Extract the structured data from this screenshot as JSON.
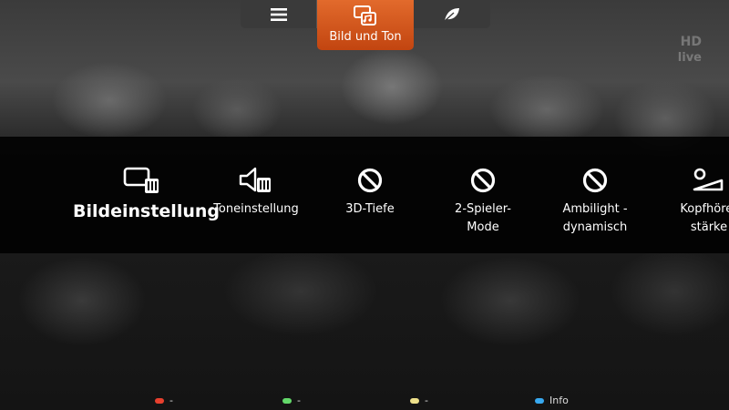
{
  "channel": {
    "name": "HD",
    "status": "live"
  },
  "tabs": [
    {
      "icon": "menu-icon",
      "label": ""
    },
    {
      "icon": "picture-sound-icon",
      "label": "Bild und Ton",
      "active": true
    },
    {
      "icon": "leaf-icon",
      "label": ""
    }
  ],
  "items": [
    {
      "icon": "picture-settings-icon",
      "label": "Bildeinstellung",
      "selected": true
    },
    {
      "icon": "sound-settings-icon",
      "label": "Toneinstellung"
    },
    {
      "icon": "unavailable-icon",
      "label": "3D-Tiefe"
    },
    {
      "icon": "unavailable-icon",
      "label": "2-Spieler-\nMode"
    },
    {
      "icon": "unavailable-icon",
      "label": "Ambilight -\ndynamisch"
    },
    {
      "icon": "headphone-volume-icon",
      "label": "Kopfhörer\nstärke"
    }
  ],
  "footer": {
    "red": {
      "color": "#e8402e",
      "label": "-"
    },
    "green": {
      "color": "#63d86a",
      "label": "-"
    },
    "yellow": {
      "color": "#ede08a",
      "label": "-"
    },
    "blue": {
      "color": "#38a9f0",
      "label": "Info"
    }
  },
  "colors": {
    "accent": "#d9571c",
    "tab_bg": "#3a3a3a"
  }
}
